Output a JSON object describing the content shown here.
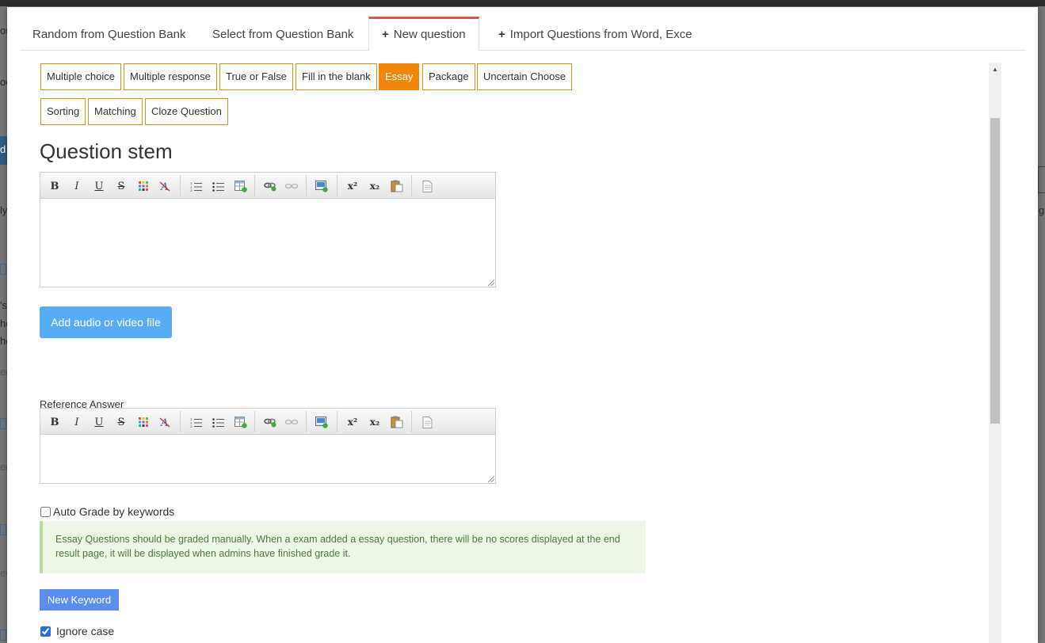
{
  "background": {
    "fragments": [
      "om",
      "oo",
      "ly",
      "d",
      "'s",
      "he",
      "he",
      "eg",
      "eg",
      "eg",
      "g"
    ]
  },
  "tabs": [
    {
      "label": "Random from Question Bank",
      "icon": "",
      "active": false
    },
    {
      "label": "Select from Question Bank",
      "icon": "",
      "active": false
    },
    {
      "label": "New question",
      "icon": "+",
      "active": true
    },
    {
      "label": "Import Questions from Word, Exce",
      "icon": "+",
      "active": false
    }
  ],
  "question_types": {
    "row1": [
      "Multiple choice",
      "Multiple response",
      "True or False",
      "Fill in the blank",
      "Essay",
      "Package",
      "Uncertain Choose"
    ],
    "row2": [
      "Sorting",
      "Matching",
      "Cloze Question"
    ],
    "selected": "Essay"
  },
  "stem": {
    "title": "Question stem",
    "toolbar": {
      "bold": "B",
      "italic": "I",
      "underline": "U",
      "strike": "S",
      "superscript": "x²",
      "subscript": "x₂"
    }
  },
  "media_button": "Add audio or video file",
  "reference": {
    "label": "Reference Answer",
    "toolbar": {
      "bold": "B",
      "italic": "I",
      "underline": "U",
      "strike": "S",
      "superscript": "x²",
      "subscript": "x₂"
    }
  },
  "auto_grade": {
    "label": "Auto Grade by keywords",
    "checked": false
  },
  "note": "Essay Questions should be graded manually. When a exam added a essay question, there will be no scores displayed at the end result page, it will be displayed when admins have finished grade it.",
  "new_keyword_button": "New Keyword",
  "ignore_case": {
    "label": "Ignore case",
    "checked": true
  },
  "colors": {
    "type_border": "#d4900f",
    "type_selected": "#f0870a",
    "media_button": "#5aabf5",
    "keyword_button": "#5b8def",
    "active_tab_top": "#d9534f",
    "note_bg": "#eef6e8",
    "note_text": "#4f7a3a"
  }
}
